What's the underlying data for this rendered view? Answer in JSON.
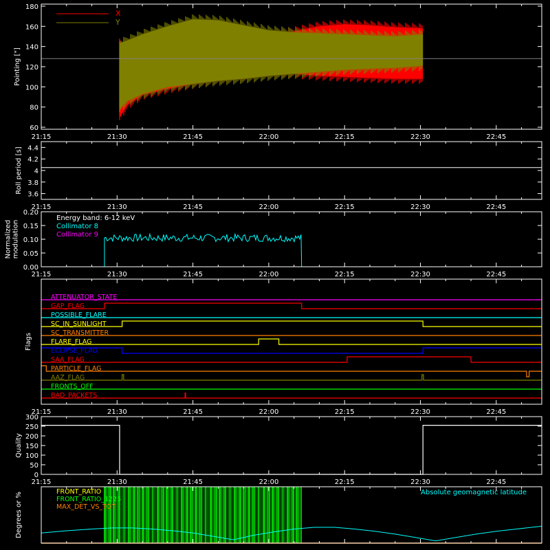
{
  "time_axis": {
    "tick_labels": [
      "21:15",
      "21:30",
      "21:45",
      "22:00",
      "22:15",
      "22:30",
      "22:45"
    ],
    "tick_minutes": [
      0,
      15,
      30,
      45,
      60,
      75,
      90
    ],
    "range_minutes": [
      0,
      99
    ]
  },
  "colors": {
    "background": "#000000",
    "axes": "#ffffff",
    "x_series": "#ff0000",
    "y_series": "#808000",
    "cyan": "#00ffff",
    "magenta": "#ff00ff",
    "green": "#00ff00",
    "orange": "#ff8000",
    "yellow": "#ffff00",
    "blue": "#0000ff",
    "red": "#ff0000"
  },
  "chart_data": [
    {
      "id": "pointing",
      "type": "area",
      "ylabel": "Pointing [\"]",
      "ylim": [
        58,
        182
      ],
      "yticks": [
        60,
        80,
        100,
        120,
        140,
        160,
        180
      ],
      "reference_line": 128,
      "legend": [
        {
          "name": "X",
          "color": "#ff0000"
        },
        {
          "name": "Y",
          "color": "#808000"
        }
      ],
      "series": [
        {
          "name": "X",
          "color": "#ff0000",
          "x_minutes": [
            15.5,
            17,
            20,
            25,
            30,
            35,
            40,
            45,
            50,
            55,
            60,
            65,
            70,
            75.5
          ],
          "upper": [
            145,
            140,
            140,
            139,
            139,
            142,
            146,
            150,
            155,
            160,
            162,
            161,
            159,
            158
          ],
          "lower": [
            70,
            82,
            92,
            98,
            103,
            108,
            111,
            114,
            113,
            111,
            110,
            109,
            108,
            108
          ]
        },
        {
          "name": "Y",
          "color": "#808000",
          "x_minutes": [
            15.5,
            17,
            20,
            25,
            30,
            35,
            40,
            45,
            50,
            55,
            60,
            65,
            70,
            75.5
          ],
          "upper": [
            143,
            146,
            152,
            160,
            167,
            166,
            161,
            156,
            154,
            153,
            152,
            151,
            150,
            152
          ],
          "lower": [
            78,
            86,
            93,
            100,
            103,
            106,
            108,
            111,
            113,
            115,
            117,
            118,
            119,
            121
          ]
        }
      ]
    },
    {
      "id": "roll_period",
      "type": "line",
      "ylabel": "Roll period [s]",
      "ylim": [
        3.5,
        4.5
      ],
      "yticks": [
        3.6,
        3.8,
        4.0,
        4.2,
        4.4
      ],
      "series": [
        {
          "name": "",
          "color": "#ffffff",
          "x_minutes": [
            0,
            99
          ],
          "values": [
            4.05,
            4.05
          ]
        }
      ]
    },
    {
      "id": "modulation",
      "type": "line",
      "ylabel": "Normalized modulation",
      "ylim": [
        0,
        0.2
      ],
      "yticks": [
        0.0,
        0.05,
        0.1,
        0.15,
        0.2
      ],
      "ytick_labels": [
        "0.00",
        "0.05",
        "0.10",
        "0.15",
        "0.20"
      ],
      "legend": [
        {
          "name": "Energy band: 6-12 keV",
          "color": "#ffffff"
        },
        {
          "name": "Collimator 8",
          "color": "#00ffff"
        },
        {
          "name": "Collimator 9",
          "color": "#ff00ff"
        }
      ],
      "series": [
        {
          "name": "Collimator 8",
          "color": "#00ffff",
          "x_start": 12.5,
          "x_end": 51.5,
          "mean": 0.105,
          "spread": 0.014
        },
        {
          "name": "Collimator 9",
          "color": "#ff00ff",
          "x_minutes": [
            0,
            99
          ],
          "values": [
            0,
            0
          ]
        }
      ]
    },
    {
      "id": "flags",
      "type": "line",
      "ylabel": "Flags",
      "flags": [
        {
          "name": "ATTENUATOR_STATE",
          "color": "#ff00ff",
          "segments": [
            [
              0,
              99,
              0
            ]
          ]
        },
        {
          "name": "GAP_FLAG",
          "color": "#ff0000",
          "segments": [
            [
              0,
              12.5,
              0
            ],
            [
              12.5,
              51.5,
              1
            ],
            [
              51.5,
              99,
              0
            ]
          ],
          "inverted": true
        },
        {
          "name": "POSSIBLE_FLARE",
          "color": "#00ffff",
          "segments": [
            [
              0,
              99,
              0
            ]
          ]
        },
        {
          "name": "SC_IN_SUNLIGHT",
          "color": "#ffff00",
          "segments": [
            [
              0,
              16,
              0
            ],
            [
              16,
              75.5,
              1
            ],
            [
              75.5,
              99,
              0
            ]
          ]
        },
        {
          "name": "SC_TRANSMITTER",
          "color": "#ff8000",
          "segments": [
            [
              0,
              99,
              0
            ]
          ]
        },
        {
          "name": "FLARE_FLAG",
          "color": "#ffff00",
          "segments": [
            [
              0,
              43,
              0
            ],
            [
              43,
              47,
              1
            ],
            [
              47,
              99,
              0
            ]
          ]
        },
        {
          "name": "ECLIPSE_FLAG",
          "color": "#0000ff",
          "segments": [
            [
              0,
              16,
              1
            ],
            [
              16,
              75.5,
              0
            ],
            [
              75.5,
              99,
              1
            ]
          ]
        },
        {
          "name": "SAA_FLAG",
          "color": "#ff0000",
          "segments": [
            [
              0,
              60.5,
              0
            ],
            [
              60.5,
              85,
              1
            ],
            [
              85,
              99,
              0
            ]
          ]
        },
        {
          "name": "PARTICLE_FLAG",
          "color": "#ff8000",
          "segments": [
            [
              0,
              1,
              1
            ],
            [
              1,
              96,
              0
            ],
            [
              96,
              96.5,
              -1
            ],
            [
              96.5,
              99,
              0
            ]
          ]
        },
        {
          "name": "AAZ_FLAG",
          "color": "#808000",
          "segments": [
            [
              0,
              16,
              0
            ],
            [
              16,
              16.3,
              1
            ],
            [
              16.3,
              75.3,
              0
            ],
            [
              75.3,
              75.6,
              1
            ],
            [
              75.6,
              99,
              0
            ]
          ]
        },
        {
          "name": "FRONTS_OFF",
          "color": "#00ff00",
          "segments": [
            [
              0,
              99,
              0
            ]
          ]
        },
        {
          "name": "BAD_PACKETS",
          "color": "#ff0000",
          "segments": [
            [
              0,
              99,
              0
            ]
          ],
          "spikes": [
            28.5
          ]
        }
      ]
    },
    {
      "id": "quality",
      "type": "line",
      "ylabel": "Quality",
      "ylim": [
        0,
        300
      ],
      "yticks": [
        0,
        50,
        100,
        150,
        200,
        250,
        300
      ],
      "series": [
        {
          "name": "",
          "color": "#ffffff",
          "x_minutes": [
            0,
            15.5,
            15.5,
            75.5,
            75.5,
            99
          ],
          "values": [
            255,
            255,
            0,
            0,
            255,
            255
          ]
        }
      ]
    },
    {
      "id": "geomagnetic",
      "type": "area",
      "ylabel": "Degrees or %",
      "ylim": [
        0,
        100
      ],
      "legend": [
        {
          "name": "FRONT_RATIO",
          "color": "#ffff00"
        },
        {
          "name": "FRONT_RATIO_1225",
          "color": "#00ff00"
        },
        {
          "name": "MAX_DET_VS_TOT",
          "color": "#ff8000"
        }
      ],
      "annotation": {
        "text": "Absolute geomagnetic latitude",
        "color": "#00ffff"
      },
      "series": [
        {
          "name": "Absolute geomagnetic latitude",
          "color": "#00ffff",
          "x_minutes": [
            0,
            5,
            10,
            14,
            18,
            22,
            26,
            30,
            34,
            38,
            42,
            46,
            50,
            54,
            58,
            62,
            66,
            70,
            74,
            78,
            82,
            86,
            90,
            94,
            99
          ],
          "values": [
            18,
            22,
            25,
            27,
            27,
            25,
            22,
            18,
            12,
            6,
            14,
            20,
            25,
            28,
            28,
            25,
            21,
            16,
            10,
            4,
            10,
            16,
            21,
            25,
            30
          ]
        },
        {
          "name": "FRONT_RATIO_1225",
          "color": "#00ff00",
          "x_start": 12.5,
          "x_end": 51.5,
          "value": 100
        }
      ]
    }
  ]
}
